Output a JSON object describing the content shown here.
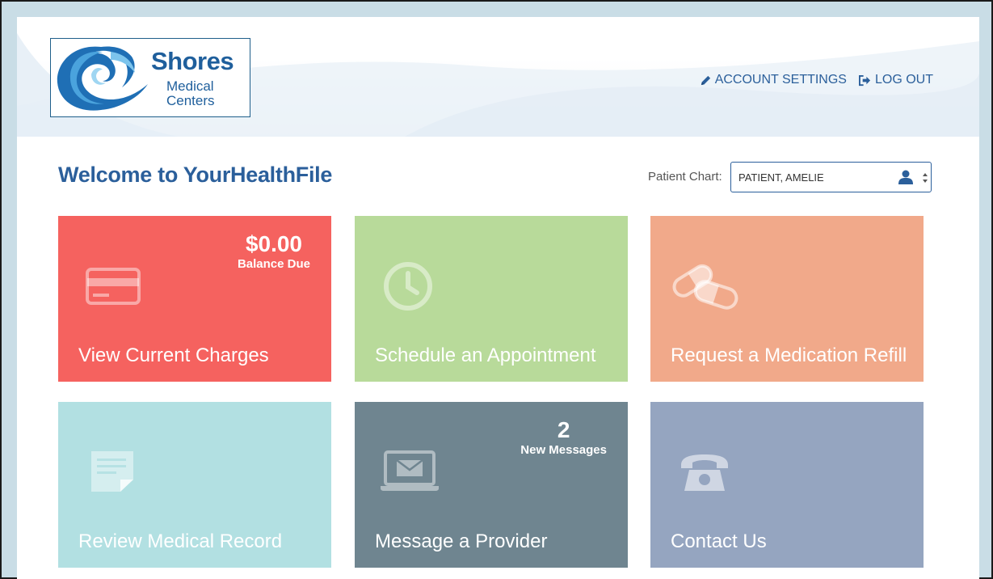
{
  "logo": {
    "name": "Shores",
    "line1": "Medical",
    "line2": "Centers"
  },
  "nav": {
    "account_settings": "ACCOUNT SETTINGS",
    "log_out": "LOG OUT"
  },
  "welcome": "Welcome to YourHealthFile",
  "patient_chart": {
    "label": "Patient Chart:",
    "selected": "PATIENT, AMELIE"
  },
  "tiles": [
    {
      "title": "View Current Charges",
      "icon": "credit-card-icon",
      "stat_value": "$0.00",
      "stat_label": "Balance Due"
    },
    {
      "title": "Schedule an Appointment",
      "icon": "clock-icon"
    },
    {
      "title": "Request a Medication Refill",
      "icon": "pills-icon"
    },
    {
      "title": "Review Medical Record",
      "icon": "document-icon"
    },
    {
      "title": "Message a Provider",
      "icon": "laptop-mail-icon",
      "stat_value": "2",
      "stat_label": "New Messages"
    },
    {
      "title": "Contact Us",
      "icon": "telephone-icon"
    }
  ],
  "colors": {
    "brand_blue": "#2b5f9b",
    "charges": "#f5625f",
    "appointment": "#b8da9a",
    "refill": "#f1a98a",
    "record": "#b2e0e2",
    "message": "#6f8590",
    "contact": "#95a5c0"
  }
}
